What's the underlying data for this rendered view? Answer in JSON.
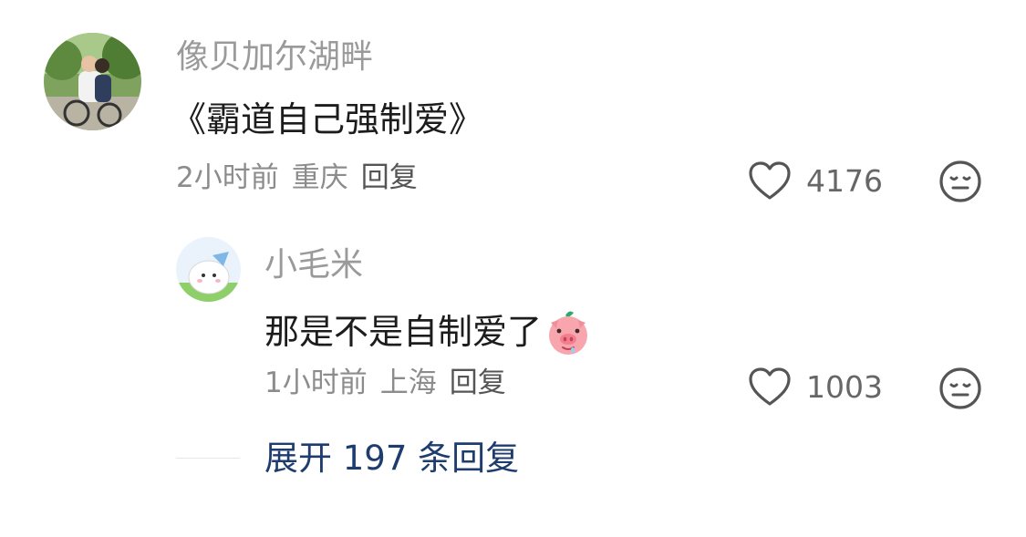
{
  "comment": {
    "username": "像贝加尔湖畔",
    "text": "《霸道自己强制爱》",
    "time": "2小时前",
    "location": "重庆",
    "reply_label": "回复",
    "likes": "4176"
  },
  "reply": {
    "username": "小毛米",
    "text": "那是不是自制爱了",
    "emoji": "pig-face-emoji",
    "time": "1小时前",
    "location": "上海",
    "reply_label": "回复",
    "likes": "1003"
  },
  "expand": {
    "label": "展开 197 条回复"
  },
  "colors": {
    "username": "#9a9a9a",
    "content": "#1c1c1c",
    "meta": "#8c8c8c",
    "link": "#1e3d6e"
  }
}
